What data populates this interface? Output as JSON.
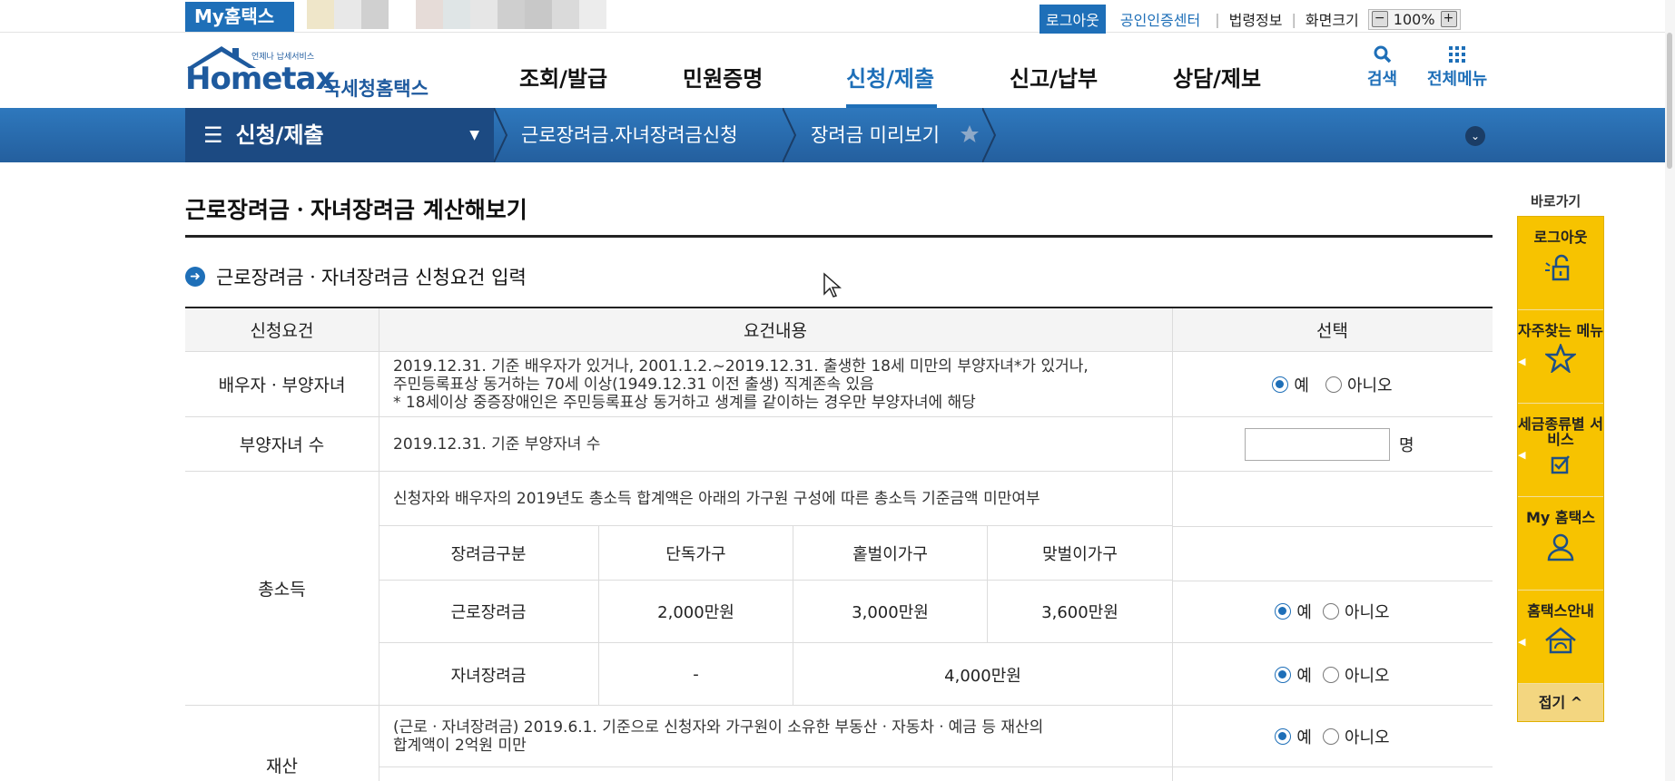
{
  "topbar": {
    "my_hometax": "My홈택스",
    "logout": "로그아웃",
    "cert_center": "공인인증센터",
    "law_info": "법령정보",
    "screen_size": "화면크기",
    "zoom": "100%"
  },
  "header": {
    "logo_text": "Hometax",
    "logo_kor": "국세청홈택스",
    "logo_tag": "언제나 납세서비스",
    "nav": [
      "조회/발급",
      "민원증명",
      "신청/제출",
      "신고/납부",
      "상담/제보"
    ],
    "active_nav": "신청/제출",
    "search": "검색",
    "all_menu": "전체메뉴"
  },
  "location": {
    "home": "신청/제출",
    "step1": "근로장려금.자녀장려금신청",
    "step2": "장려금 미리보기"
  },
  "main": {
    "page_title": "근로장려금ㆍ자녀장려금 계산해보기",
    "section_title": "근로장려금ㆍ자녀장려금 신청요건 입력",
    "table": {
      "headers": [
        "신청요건",
        "요건내용",
        "선택"
      ],
      "spouse_label": "배우자ㆍ부양자녀",
      "spouse_desc1": "2019.12.31. 기준 배우자가 있거나, 2001.1.2.~2019.12.31. 출생한 18세 미만의 부양자녀*가 있거나,",
      "spouse_desc2": "주민등록표상 동거하는 70세 이상(1949.12.31 이전 출생) 직계존속 있음",
      "spouse_desc3": "* 18세이상 중증장애인은 주민등록표상 동거하고 생계를 같이하는 경우만 부양자녀에 해당",
      "children_label": "부양자녀 수",
      "children_desc": "2019.12.31. 기준 부양자녀 수",
      "children_unit": "명",
      "income_label": "총소득",
      "income_desc": "신청자와 배우자의 2019년도 총소득 합계액은 아래의 가구원 구성에 따른 총소득 기준금액 미만여부",
      "income_sub_headers": [
        "장려금구분",
        "단독가구",
        "홑벌이가구",
        "맞벌이가구"
      ],
      "income_rows": [
        {
          "type": "근로장려금",
          "single": "2,000만원",
          "one": "3,000만원",
          "dual": "3,600만원"
        },
        {
          "type": "자녀장려금",
          "single": "-",
          "merged": "4,000만원"
        }
      ],
      "asset_label": "재산",
      "asset_desc1": "(근로ㆍ자녀장려금) 2019.6.1. 기준으로 신청자와 가구원이 소유한 부동산ㆍ자동차ㆍ예금 등 재산의",
      "asset_desc2": "합계액이 2억원 미만",
      "yes": "예",
      "no": "아니오"
    }
  },
  "quick": {
    "title": "바로가기",
    "items": [
      "로그아웃",
      "자주찾는 메뉴",
      "세금종류별 서비스",
      "My 홈택스",
      "홈택스안내"
    ],
    "fold": "접기 ^"
  },
  "colors": {
    "brand": "#1e6fb8",
    "quick_bg": "#f7c300",
    "locbar": "#245f9e"
  }
}
